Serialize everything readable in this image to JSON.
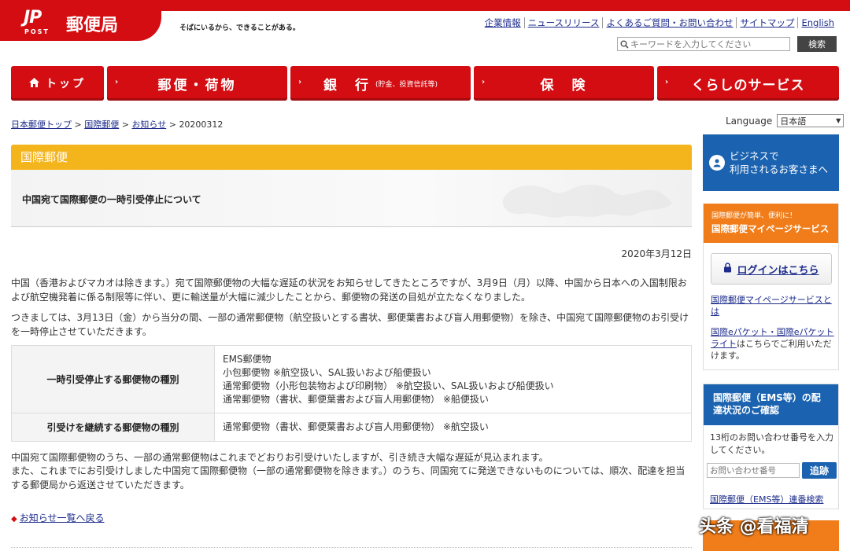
{
  "header": {
    "logo_mark": "JP",
    "logo_post": "POST",
    "logo_name": "郵便局",
    "slogan": "そばにいるから、できることがある。",
    "utility_links": [
      "企業情報",
      "ニュースリリース",
      "よくあるご質問・お問い合わせ",
      "サイトマップ",
      "English"
    ],
    "search_placeholder": "キーワードを入力してください",
    "search_button": "検索"
  },
  "nav": {
    "home": "トップ",
    "mail": "郵便・荷物",
    "bank": "銀　行",
    "bank_note": "(貯金、投資信託等)",
    "insurance": "保　険",
    "life": "くらしのサービス"
  },
  "breadcrumb": {
    "items": [
      "日本郵便トップ",
      "国際郵便",
      "お知らせ"
    ],
    "current": "20200312",
    "sep": ">"
  },
  "language": {
    "label": "Language",
    "selected": "日本語"
  },
  "main": {
    "section": "国際郵便",
    "title": "中国宛て国際郵便の一時引受停止について",
    "date": "2020年3月12日",
    "para1": "中国（香港およびマカオは除きます。）宛て国際郵便物の大幅な遅延の状況をお知らせしてきたところですが、3月9日（月）以降、中国から日本への入国制限および航空機発着に係る制限等に伴い、更に輸送量が大幅に減少したことから、郵便物の発送の目処が立たなくなりました。",
    "para2": "つきましては、3月13日（金）から当分の間、一部の通常郵便物（航空扱いとする書状、郵便葉書および盲人用郵便物）を除き、中国宛て国際郵便物のお引受けを一時停止させていただきます。",
    "table": [
      {
        "head": "一時引受停止する郵便物の種別",
        "lines": [
          "EMS郵便物",
          "小包郵便物 ※航空扱い、SAL扱いおよび船便扱い",
          "通常郵便物（小形包装物および印刷物） ※航空扱い、SAL扱いおよび船便扱い",
          "通常郵便物（書状、郵便葉書および盲人用郵便物） ※船便扱い"
        ]
      },
      {
        "head": "引受けを継続する郵便物の種別",
        "lines": [
          "通常郵便物（書状、郵便葉書および盲人用郵便物） ※航空扱い"
        ]
      }
    ],
    "para3": "中国宛て国際郵便物のうち、一部の通常郵便物はこれまでどおりお引受けいたしますが、引き続き大幅な遅延が見込まれます。",
    "para4": "また、これまでにお引受けしました中国宛て国際郵便物（一部の通常郵便物を除きます。）のうち、同国宛てに発送できないものについては、順次、配達を担当する郵便局から返送させていただきます。",
    "back_link": "お知らせ一覧へ戻る"
  },
  "side": {
    "biz": "ビジネスで\n利用されるお客さまへ",
    "mypage_small": "国際郵便が簡単、便利に！",
    "mypage_title": "国際郵便マイページサービス",
    "login": "ログインはこちら",
    "link1": "国際郵便マイページサービスとは",
    "link2_a": "国際eパケット・国際eパケットライト",
    "link2_b": "はこちらでご利用いただけます。",
    "track_title": "国際郵便（EMS等）の配達状況のご確認",
    "track_desc": "13桁のお問い合わせ番号を入力してください。",
    "track_placeholder": "お問い合わせ番号",
    "track_button": "追跡",
    "track_link": "国際郵便（EMS等）連番検索"
  },
  "watermark": "头条 @看福清",
  "colors": {
    "brand_red": "#d30d12",
    "section_yellow": "#f4b41c",
    "blue": "#1b63b0",
    "orange": "#f07d1a",
    "link": "#1e2d8c"
  }
}
